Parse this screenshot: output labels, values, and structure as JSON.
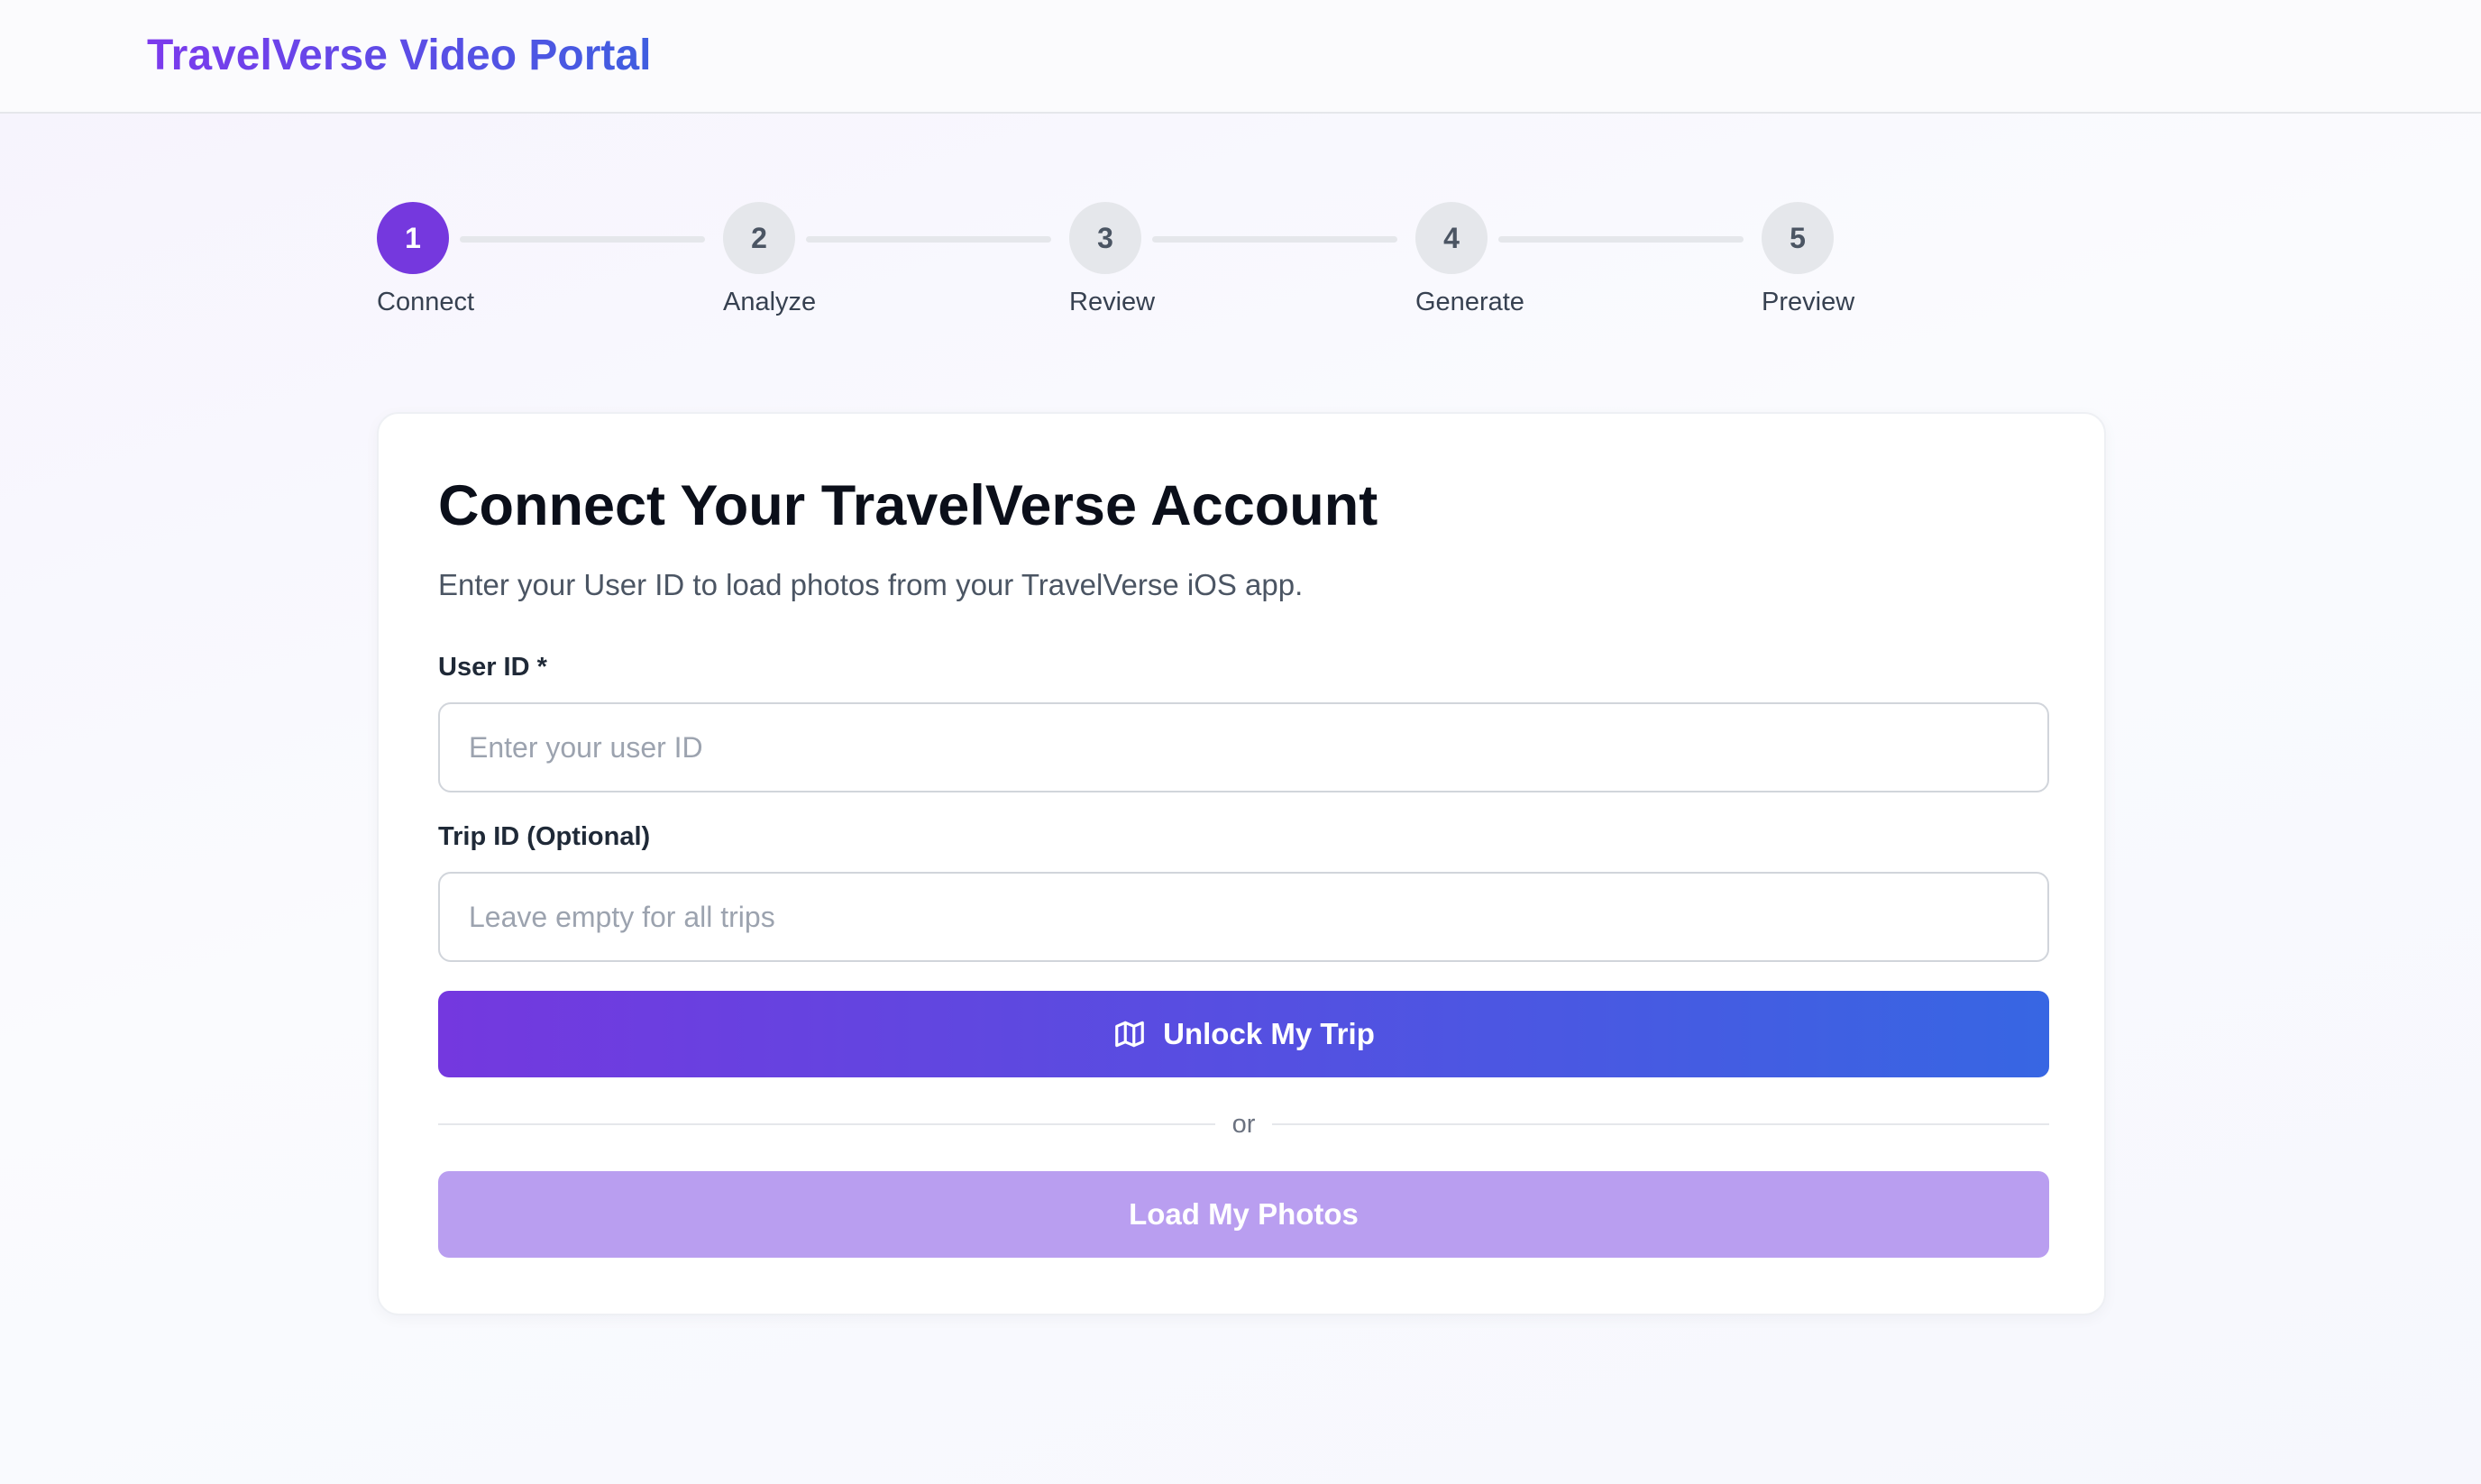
{
  "header": {
    "brand": "TravelVerse Video Portal"
  },
  "stepper": {
    "current_step": 1,
    "steps": [
      {
        "number": "1",
        "label": "Connect",
        "active": true
      },
      {
        "number": "2",
        "label": "Analyze",
        "active": false
      },
      {
        "number": "3",
        "label": "Review",
        "active": false
      },
      {
        "number": "4",
        "label": "Generate",
        "active": false
      },
      {
        "number": "5",
        "label": "Preview",
        "active": false
      }
    ]
  },
  "card": {
    "title": "Connect Your TravelVerse Account",
    "subtitle": "Enter your User ID to load photos from your TravelVerse iOS app.",
    "user_id": {
      "label": "User ID *",
      "value": "",
      "placeholder": "Enter your user ID"
    },
    "trip_id": {
      "label": "Trip ID (Optional)",
      "value": "",
      "placeholder": "Leave empty for all trips"
    },
    "unlock_button": {
      "label": "Unlock My Trip",
      "icon": "map-icon"
    },
    "divider_text": "or",
    "load_button": {
      "label": "Load My Photos"
    }
  },
  "colors": {
    "accent_purple": "#7538de",
    "accent_blue": "#3766e3",
    "secondary_button": "#b99ef0",
    "step_inactive": "#e5e7eb"
  }
}
